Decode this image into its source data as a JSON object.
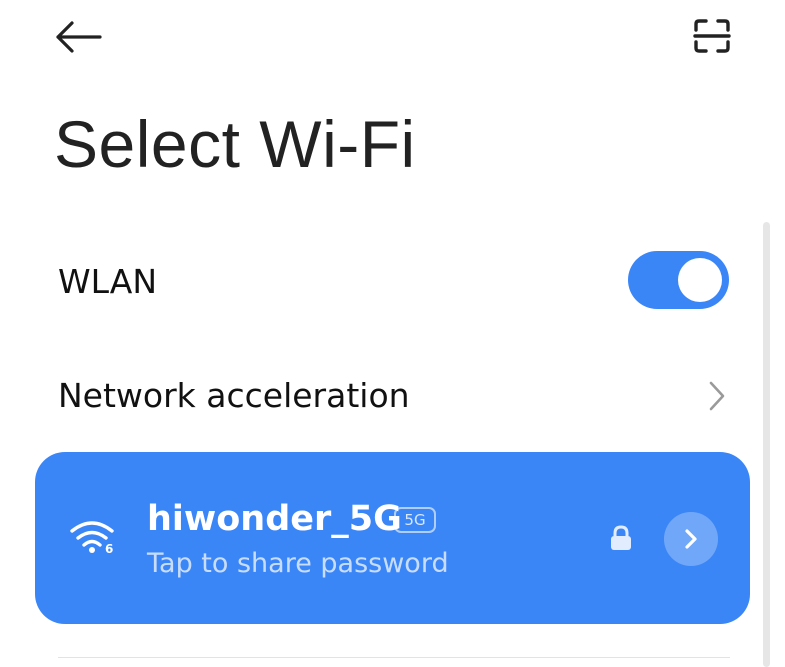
{
  "header": {
    "back_icon": "arrow-left-icon",
    "scan_icon": "scan-qr-icon"
  },
  "page": {
    "title": "Select Wi-Fi"
  },
  "settings": {
    "wlan_label": "WLAN",
    "wlan_enabled": true,
    "network_acceleration_label": "Network acceleration"
  },
  "connected_network": {
    "ssid": "hiwonder_5G",
    "band_badge": "5G",
    "subtitle": "Tap to share password",
    "signal_badge": "6",
    "secured": true
  },
  "colors": {
    "accent": "#3b86f7",
    "text_primary": "#111111",
    "background": "#ffffff"
  }
}
